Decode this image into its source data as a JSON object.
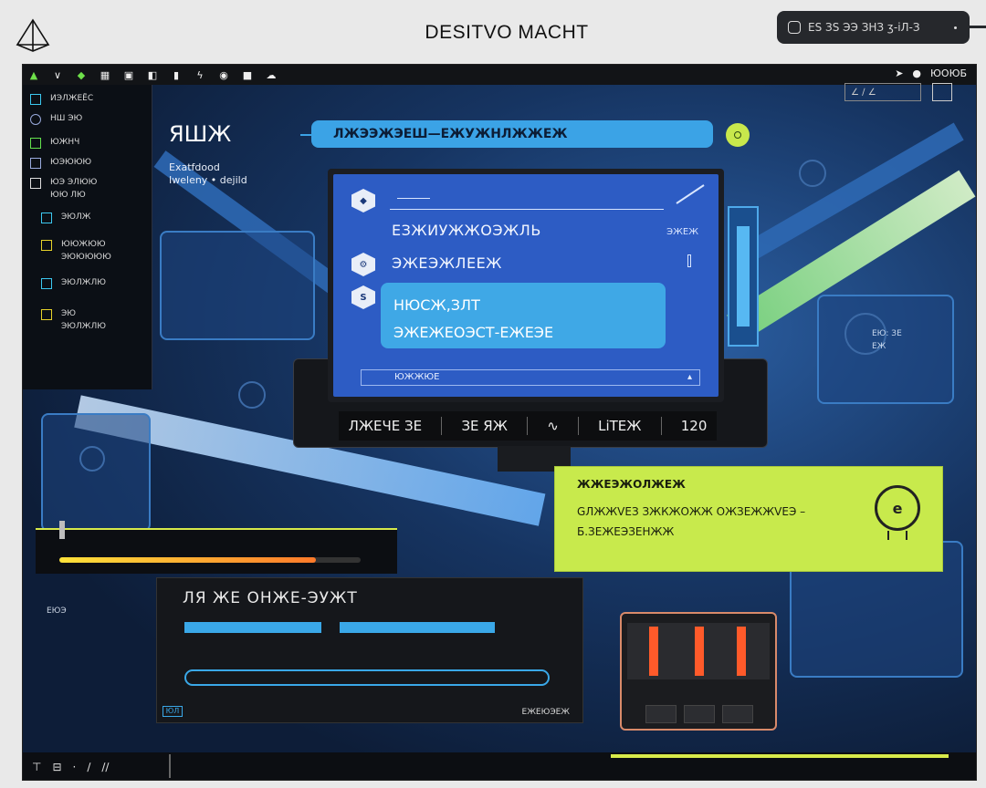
{
  "header": {
    "title": "DESITVO MACHT",
    "status_pill_text": "ES ЗS ЭЭ ЗНЗ ӡ-іЛ-З",
    "logo": "triangle-logo-icon"
  },
  "toolbar": {
    "icons": [
      "arrow-up-icon",
      "chevron-down-icon",
      "leaf-icon",
      "grid-icon",
      "save-icon",
      "frame-icon",
      "book-icon",
      "bolt-icon",
      "record-icon",
      "square-icon",
      "cloud-icon"
    ],
    "right_text": "ЮОЮБ"
  },
  "sidebar": {
    "items": [
      {
        "icon": "monitor-icon",
        "lines": [
          "ИЭЛЖЕЁС",
          ""
        ]
      },
      {
        "icon": "clock-icon",
        "lines": [
          "НШ   ЭЮ"
        ]
      },
      {
        "icon": "battery-icon",
        "lines": [
          "ЮЖНЧ"
        ]
      },
      {
        "icon": "link-icon",
        "lines": [
          "ЮЭЮЮЮ"
        ]
      },
      {
        "icon": "file-icon",
        "lines": [
          "ЮЭ  ЭЛЮЮ",
          "ЮЮ ЛЮ"
        ]
      },
      {
        "icon": "screen-icon",
        "lines": [
          "ЭЮЛЖ"
        ]
      },
      {
        "icon": "folder-icon",
        "lines": [
          "ЮЮЖЮЮ",
          "ЭЮЮЮЮЮ"
        ]
      },
      {
        "icon": "window-icon",
        "lines": [
          "ЭЮЛЖЛЮ"
        ]
      },
      {
        "icon": "note-icon",
        "lines": [
          "ЭЮ",
          "ЭЮЛЖЛЮ"
        ]
      }
    ]
  },
  "hero": {
    "title": "ЯШЖ",
    "subtitle_lines": [
      "Exatfdood",
      "Iweleny • dejild"
    ]
  },
  "search": {
    "value": "ЛЖЭЭЖЭЕШ—ЕЖУЖНЛЖЖЕЖ"
  },
  "screen": {
    "row1_text": "ЕЗЖИУЖЖОЭЖЛЬ",
    "row1_meta": "ЭЖЕЖ",
    "row2_text": "ЭЖЕЭЖЛЕЕЖ",
    "card_line1": "HЮСЖ,ЗЛТ",
    "card_line2": "ЭЖЕЖЕОЭСТ-ЕЖЕЭЕ",
    "input_value": "ЮЖЖЮЕ"
  },
  "bezel": {
    "segments": [
      "ЛЖЕЧЕ ЗЕ",
      "ЗЕ ЯЖ",
      "∿",
      "LiTEЖ",
      "120"
    ]
  },
  "right_readout": [
    "ЕЮ: ЗЕ",
    "ЕЖ"
  ],
  "meter": {
    "level_percent": 85,
    "label": "ЕЮЭ"
  },
  "dark_panel": {
    "title": "ЛЯ ЖЕ ОНЖЕ-ЭУЖТ",
    "footer_left": "ЮЛ",
    "footer_right": "ЕЖЕЮЭЕЖ"
  },
  "lime_card": {
    "title": "ЖЖЕЭЖОЛЖЕЖ",
    "body_line1": "GЛЖЖVЕЗ ЗЖКЖОЖЖ ОЖЗЕЖЖVЕЭ –",
    "body_line2": "Б.ЗЕЖЕЭЗЕНЖЖ",
    "avatar_letter": "e"
  },
  "bottom_bar": {
    "icons": [
      "pin-icon",
      "ruler-icon",
      "dot-icon",
      "pen-icon",
      "slash-icon"
    ]
  },
  "colors": {
    "accent_blue": "#3ba3e6",
    "accent_lime": "#c8ea4c",
    "accent_orange": "#ff5a2a",
    "bg_dark": "#0f1a2e"
  }
}
